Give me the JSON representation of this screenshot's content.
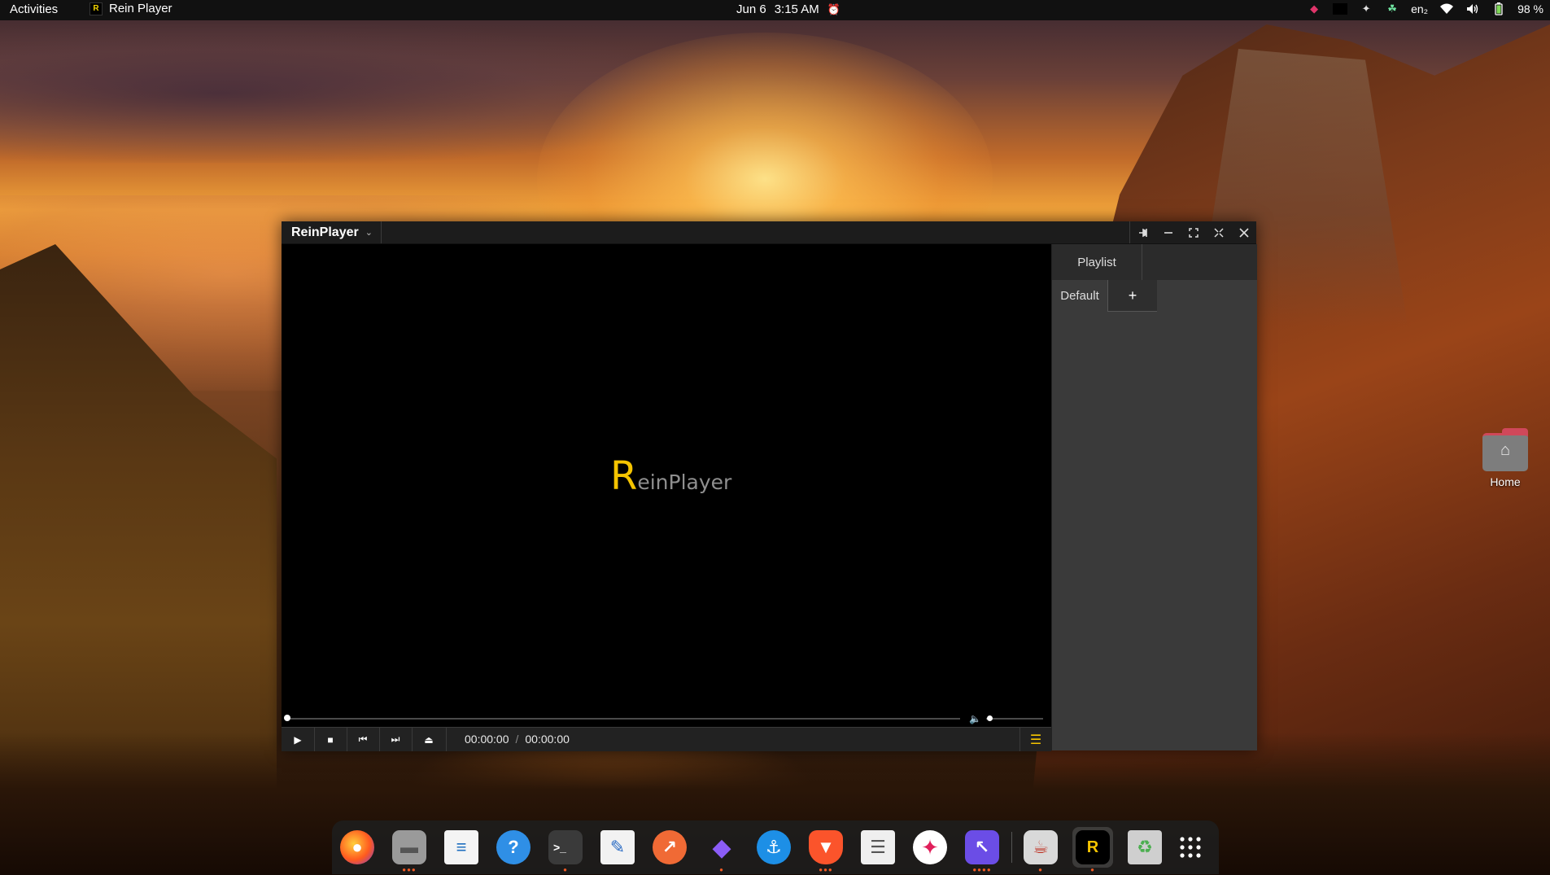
{
  "topbar": {
    "activities": "Activities",
    "app_name": "Rein Player",
    "app_glyph": "R",
    "date": "Jun 6",
    "time": "3:15 AM",
    "lang": "en₂",
    "battery": "98 %"
  },
  "window": {
    "title": "ReinPlayer",
    "logo_big": "R",
    "logo_rest": "einPlayer",
    "time_current": "00:00:00",
    "time_sep": "/",
    "time_total": "00:00:00",
    "playlist_tab": "Playlist",
    "playlist_default": "Default",
    "add_playlist": "+",
    "progress": 0,
    "volume": 0
  },
  "desktop": {
    "home_label": "Home"
  },
  "dock": {
    "items": [
      {
        "name": "firefox",
        "glyph": "●"
      },
      {
        "name": "files",
        "glyph": "▬"
      },
      {
        "name": "writer",
        "glyph": "≡"
      },
      {
        "name": "help",
        "glyph": "?"
      },
      {
        "name": "terminal",
        "glyph": ">_"
      },
      {
        "name": "text-editor",
        "glyph": "✎"
      },
      {
        "name": "postman",
        "glyph": "↗"
      },
      {
        "name": "obsidian",
        "glyph": "◆"
      },
      {
        "name": "docker",
        "glyph": "⚓"
      },
      {
        "name": "brave",
        "glyph": "▼"
      },
      {
        "name": "document-viewer",
        "glyph": "☰"
      },
      {
        "name": "slack",
        "glyph": "✦"
      },
      {
        "name": "pointer-tool",
        "glyph": "↖"
      },
      {
        "name": "java-ide",
        "glyph": "☕"
      },
      {
        "name": "reinplayer",
        "glyph": "R"
      },
      {
        "name": "trash",
        "glyph": "♻"
      },
      {
        "name": "show-apps",
        "glyph": "∷"
      }
    ]
  },
  "colors": {
    "accent_yellow": "#f5c400",
    "dock_dot": "#f05a24"
  }
}
